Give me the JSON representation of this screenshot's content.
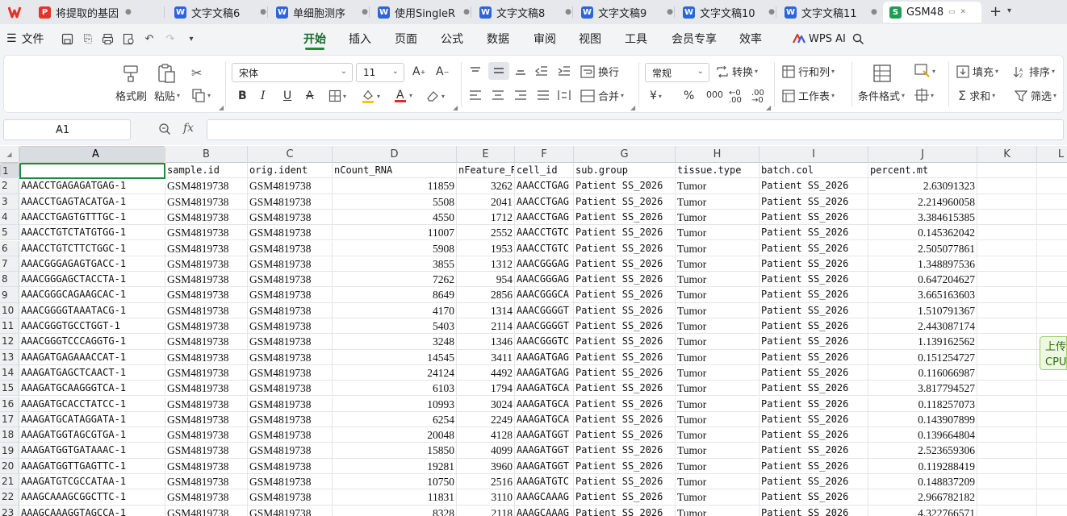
{
  "colors": {
    "accent": "#1f8a3c",
    "wps_red": "#e0352b",
    "doc_blue": "#2b65d9",
    "sheet_green": "#1f9d55"
  },
  "tabs": [
    {
      "label": "将提取的基因",
      "icon": "pdf-icon"
    },
    {
      "label": "文字文稿6",
      "icon": "word-doc-icon"
    },
    {
      "label": "单细胞测序",
      "icon": "word-doc-icon"
    },
    {
      "label": "使用SingleR",
      "icon": "word-doc-icon"
    },
    {
      "label": "文字文稿8",
      "icon": "word-doc-icon"
    },
    {
      "label": "文字文稿9",
      "icon": "word-doc-icon"
    },
    {
      "label": "文字文稿10",
      "icon": "word-doc-icon"
    },
    {
      "label": "文字文稿11",
      "icon": "word-doc-icon"
    },
    {
      "label": "GSM48",
      "icon": "spreadsheet-icon",
      "active": true
    }
  ],
  "menu": {
    "file": "文件",
    "tabs": [
      "开始",
      "插入",
      "页面",
      "公式",
      "数据",
      "审阅",
      "视图",
      "工具",
      "会员专享",
      "效率"
    ],
    "active_tab": "开始",
    "ai": "WPS AI"
  },
  "ribbon": {
    "format_painter": "格式刷",
    "paste": "粘贴",
    "font_name": "宋体",
    "font_size": "11",
    "wrap": "换行",
    "merge": "合并",
    "number_format": "常规",
    "convert": "转换",
    "rows_cols": "行和列",
    "worksheet": "工作表",
    "conditional_format": "条件格式",
    "fill": "填充",
    "sort": "排序",
    "sum": "求和",
    "filter": "筛选"
  },
  "formula_bar": {
    "name_box": "A1",
    "fx": "fx",
    "formula": ""
  },
  "grid": {
    "columns": [
      "A",
      "B",
      "C",
      "D",
      "E",
      "F",
      "G",
      "H",
      "I",
      "J",
      "K",
      "L"
    ],
    "selected_column": "A",
    "header_row": [
      "",
      "sample.id",
      "orig.ident",
      "nCount_RNA",
      "nFeature_R",
      "cell_id",
      "sub.group",
      "tissue.type",
      "batch.col",
      "percent.mt"
    ],
    "rows": [
      [
        "AAACCTGAGAGATGAG-1",
        "GSM4819738",
        "GSM4819738",
        "11859",
        "3262",
        "AAACCTGAG",
        "Patient SS_2026",
        "Tumor",
        "Patient SS_2026",
        "2.63091323"
      ],
      [
        "AAACCTGAGTACATGA-1",
        "GSM4819738",
        "GSM4819738",
        "5508",
        "2041",
        "AAACCTGAG",
        "Patient SS_2026",
        "Tumor",
        "Patient SS_2026",
        "2.214960058"
      ],
      [
        "AAACCTGAGTGTTTGC-1",
        "GSM4819738",
        "GSM4819738",
        "4550",
        "1712",
        "AAACCTGAG",
        "Patient SS_2026",
        "Tumor",
        "Patient SS_2026",
        "3.384615385"
      ],
      [
        "AAACCTGTCTATGTGG-1",
        "GSM4819738",
        "GSM4819738",
        "11007",
        "2552",
        "AAACCTGTC",
        "Patient SS_2026",
        "Tumor",
        "Patient SS_2026",
        "0.145362042"
      ],
      [
        "AAACCTGTCTTCTGGC-1",
        "GSM4819738",
        "GSM4819738",
        "5908",
        "1953",
        "AAACCTGTC",
        "Patient SS_2026",
        "Tumor",
        "Patient SS_2026",
        "2.505077861"
      ],
      [
        "AAACGGGAGAGTGACC-1",
        "GSM4819738",
        "GSM4819738",
        "3855",
        "1312",
        "AAACGGGAG",
        "Patient SS_2026",
        "Tumor",
        "Patient SS_2026",
        "1.348897536"
      ],
      [
        "AAACGGGAGCTACCTA-1",
        "GSM4819738",
        "GSM4819738",
        "7262",
        "954",
        "AAACGGGAG",
        "Patient SS_2026",
        "Tumor",
        "Patient SS_2026",
        "0.647204627"
      ],
      [
        "AAACGGGCAGAAGCAC-1",
        "GSM4819738",
        "GSM4819738",
        "8649",
        "2856",
        "AAACGGGCA",
        "Patient SS_2026",
        "Tumor",
        "Patient SS_2026",
        "3.665163603"
      ],
      [
        "AAACGGGGTAAATACG-1",
        "GSM4819738",
        "GSM4819738",
        "4170",
        "1314",
        "AAACGGGGT",
        "Patient SS_2026",
        "Tumor",
        "Patient SS_2026",
        "1.510791367"
      ],
      [
        "AAACGGGTGCCTGGT-1",
        "GSM4819738",
        "GSM4819738",
        "5403",
        "2114",
        "AAACGGGGT",
        "Patient SS_2026",
        "Tumor",
        "Patient SS_2026",
        "2.443087174"
      ],
      [
        "AAACGGGTCCCAGGTG-1",
        "GSM4819738",
        "GSM4819738",
        "3248",
        "1346",
        "AAACGGGTC",
        "Patient SS_2026",
        "Tumor",
        "Patient SS_2026",
        "1.139162562"
      ],
      [
        "AAAGATGAGAAACCAT-1",
        "GSM4819738",
        "GSM4819738",
        "14545",
        "3411",
        "AAAGATGAG",
        "Patient SS_2026",
        "Tumor",
        "Patient SS_2026",
        "0.151254727"
      ],
      [
        "AAAGATGAGCTCAACT-1",
        "GSM4819738",
        "GSM4819738",
        "24124",
        "4492",
        "AAAGATGAG",
        "Patient SS_2026",
        "Tumor",
        "Patient SS_2026",
        "0.116066987"
      ],
      [
        "AAAGATGCAAGGGTCA-1",
        "GSM4819738",
        "GSM4819738",
        "6103",
        "1794",
        "AAAGATGCA",
        "Patient SS_2026",
        "Tumor",
        "Patient SS_2026",
        "3.817794527"
      ],
      [
        "AAAGATGCACCTATCC-1",
        "GSM4819738",
        "GSM4819738",
        "10993",
        "3024",
        "AAAGATGCA",
        "Patient SS_2026",
        "Tumor",
        "Patient SS_2026",
        "0.118257073"
      ],
      [
        "AAAGATGCATAGGATA-1",
        "GSM4819738",
        "GSM4819738",
        "6254",
        "2249",
        "AAAGATGCA",
        "Patient SS_2026",
        "Tumor",
        "Patient SS_2026",
        "0.143907899"
      ],
      [
        "AAAGATGGTAGCGTGA-1",
        "GSM4819738",
        "GSM4819738",
        "20048",
        "4128",
        "AAAGATGGT",
        "Patient SS_2026",
        "Tumor",
        "Patient SS_2026",
        "0.139664804"
      ],
      [
        "AAAGATGGTGATAAAC-1",
        "GSM4819738",
        "GSM4819738",
        "15850",
        "4099",
        "AAAGATGGT",
        "Patient SS_2026",
        "Tumor",
        "Patient SS_2026",
        "2.523659306"
      ],
      [
        "AAAGATGGTTGAGTTC-1",
        "GSM4819738",
        "GSM4819738",
        "19281",
        "3960",
        "AAAGATGGT",
        "Patient SS_2026",
        "Tumor",
        "Patient SS_2026",
        "0.119288419"
      ],
      [
        "AAAGATGTCGCCATAA-1",
        "GSM4819738",
        "GSM4819738",
        "10750",
        "2516",
        "AAAGATGTC",
        "Patient SS_2026",
        "Tumor",
        "Patient SS_2026",
        "0.148837209"
      ],
      [
        "AAAGCAAAGCGGCTTC-1",
        "GSM4819738",
        "GSM4819738",
        "11831",
        "3110",
        "AAAGCAAAG",
        "Patient SS_2026",
        "Tumor",
        "Patient SS_2026",
        "2.966782182"
      ],
      [
        "AAAGCAAAGGTAGCCA-1",
        "GSM4819738",
        "GSM4819738",
        "8328",
        "2118",
        "AAAGCAAAG",
        "Patient SS_2026",
        "Tumor",
        "Patient SS_2026",
        "4.322766571"
      ]
    ]
  },
  "side_float": {
    "line1": "上传",
    "line2": "CPU"
  }
}
